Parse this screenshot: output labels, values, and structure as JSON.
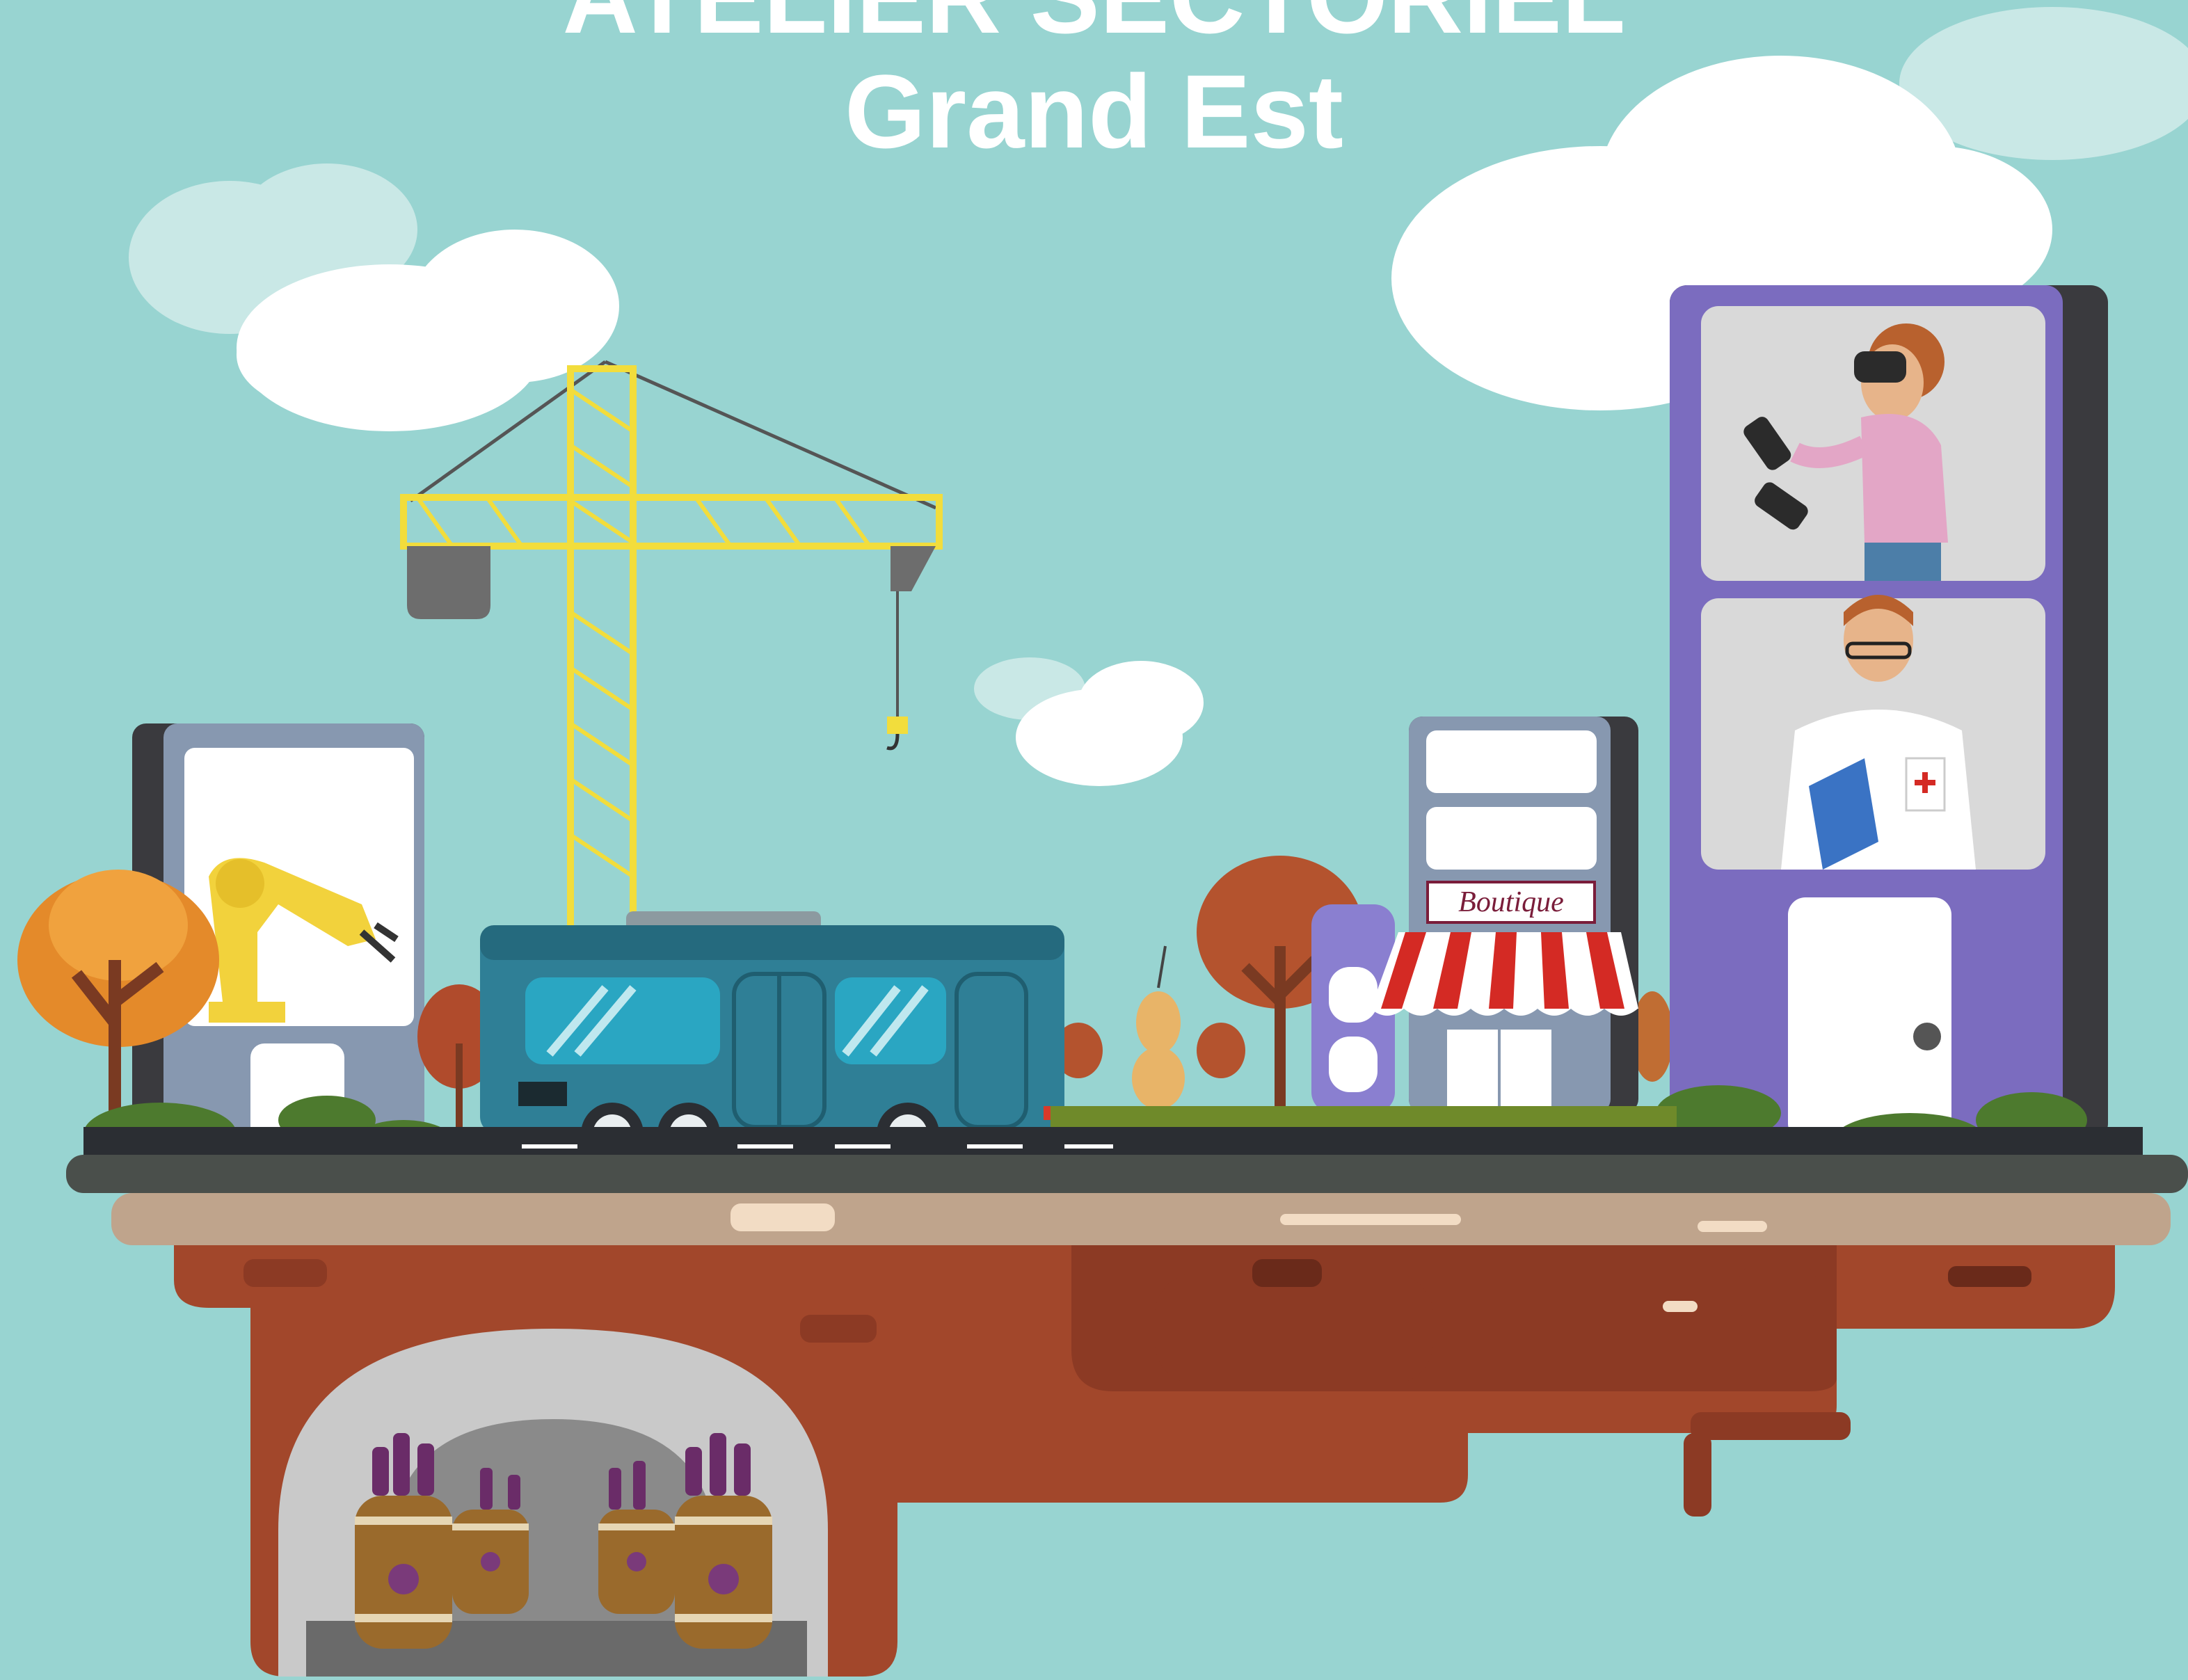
{
  "title": {
    "line1": "ATELIER SECTORIEL",
    "line2": "Grand Est"
  },
  "shop_sign": "Boutique",
  "colors": {
    "sky": "#98d4d1",
    "cloud": "#ffffff",
    "crane": "#f2dd3c",
    "bus": "#2f7f96",
    "building_purple": "#7b6cbf",
    "soil": "#8c3a24",
    "road": "#4a4f4b",
    "barrel": "#9a6a2c",
    "wine": "#6a2c68"
  },
  "icons": [
    "cloud-icon",
    "crane-icon",
    "bus-icon",
    "robot-arm-icon",
    "shop-awning-icon",
    "vr-user-icon",
    "doctor-icon",
    "wine-barrel-icon",
    "tree-icon"
  ]
}
